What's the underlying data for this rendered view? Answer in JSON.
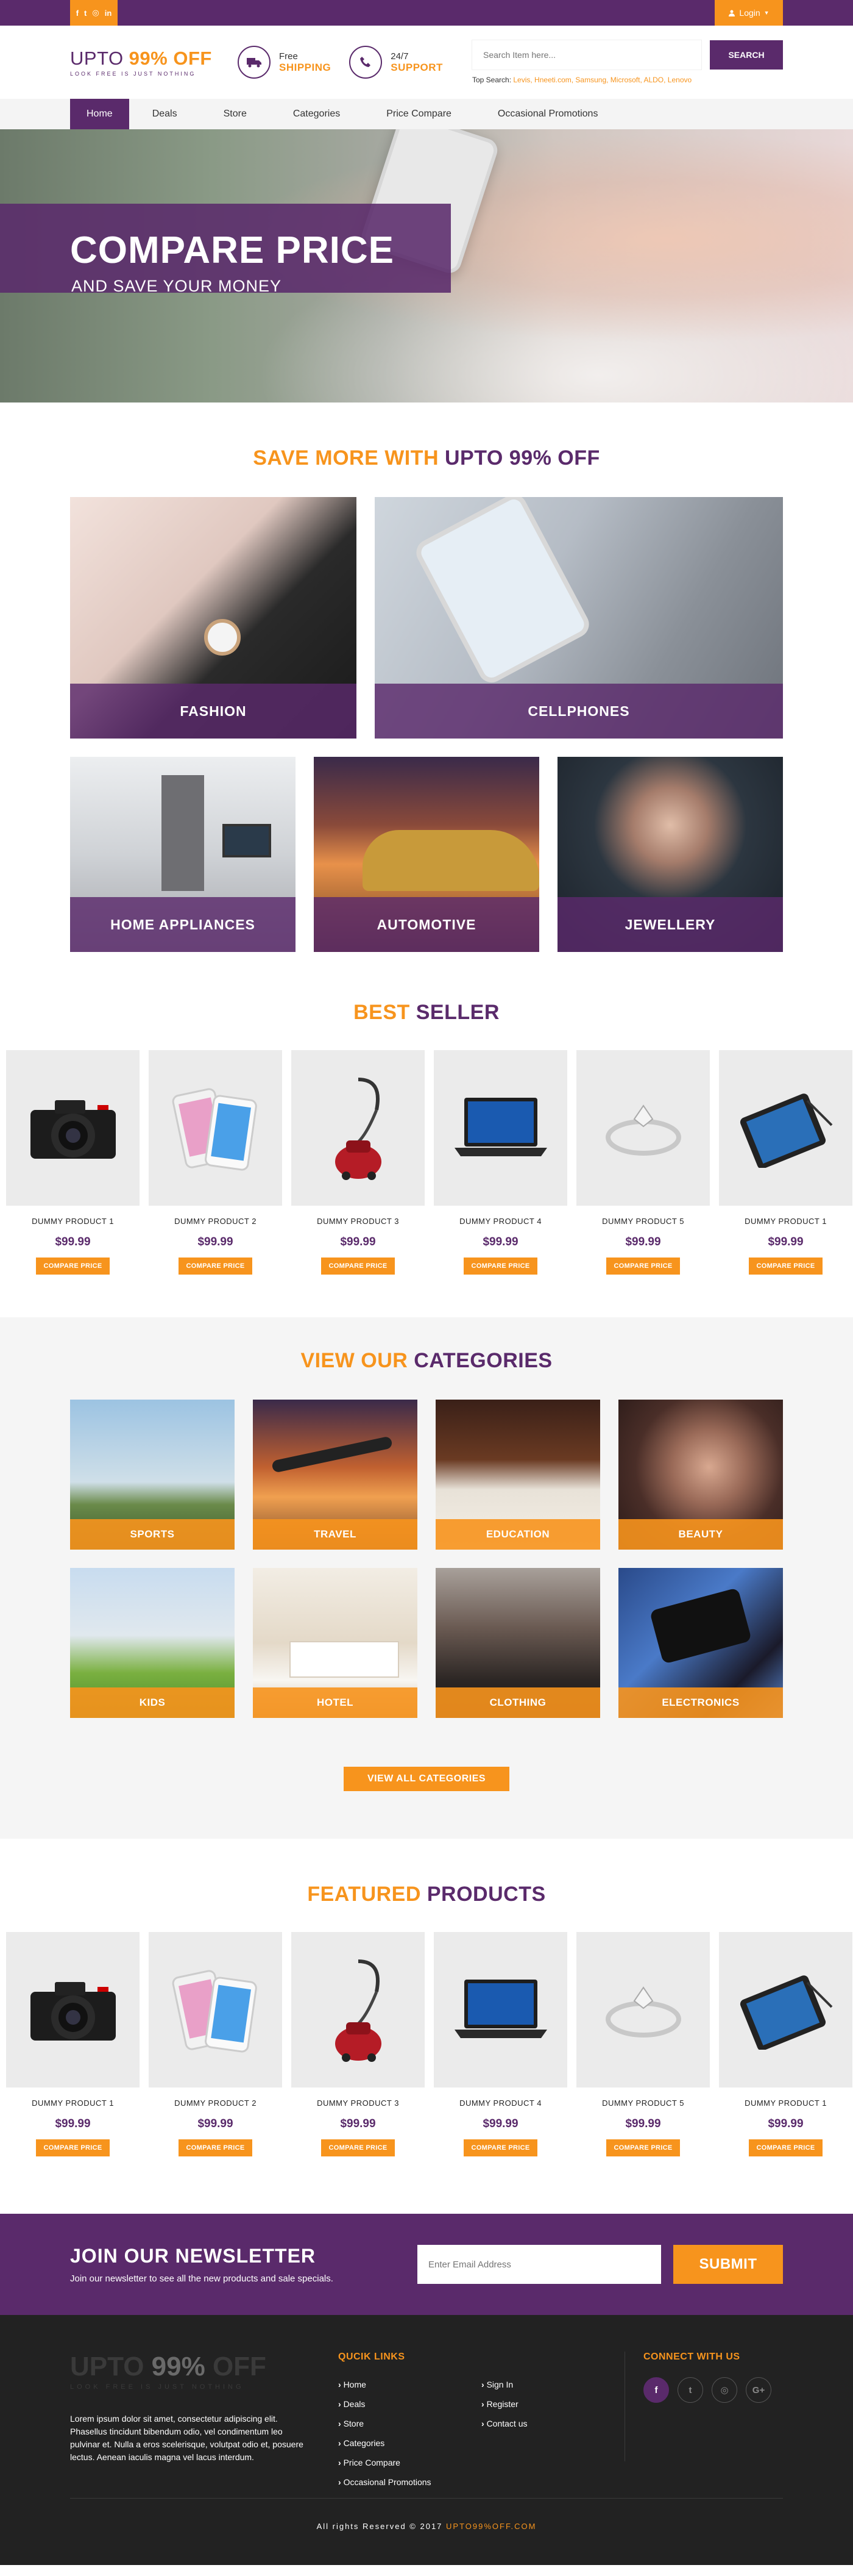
{
  "topbar": {
    "social": [
      "f",
      "t",
      "◎",
      "in"
    ],
    "login_label": "Login"
  },
  "header": {
    "logo_main_a": "UPTO ",
    "logo_main_b": "99% OFF",
    "logo_tagline": "LOOK FREE IS JUST NOTHING",
    "shipping_t1": "Free",
    "shipping_t2": "SHIPPING",
    "support_t1": "24/7",
    "support_t2": "SUPPORT",
    "search_placeholder": "Search Item here...",
    "search_button": "SEARCH",
    "top_search_label": "Top Search: ",
    "top_search_terms": "Levis, Hneeti.com, Samsung, Microsoft, ALDO, Lenovo"
  },
  "nav": [
    "Home",
    "Deals",
    "Store",
    "Categories",
    "Price Compare",
    "Occasional Promotions"
  ],
  "hero": {
    "title": "COMPARE PRICE",
    "subtitle": "AND SAVE YOUR MONEY"
  },
  "save_more": {
    "title_a": "SAVE MORE WITH ",
    "title_b": "UPTO 99% OFF",
    "tiles": [
      "FASHION",
      "CELLPHONES",
      "HOME APPLIANCES",
      "AUTOMOTIVE",
      "JEWELLERY"
    ]
  },
  "best_seller": {
    "title_a": "BEST ",
    "title_b": "SELLER"
  },
  "products": [
    {
      "name": "DUMMY PRODUCT 1",
      "price": "$99.99",
      "button": "COMPARE PRICE",
      "icon": "camera-icon"
    },
    {
      "name": "DUMMY PRODUCT 2",
      "price": "$99.99",
      "button": "COMPARE PRICE",
      "icon": "smartphones-icon"
    },
    {
      "name": "DUMMY PRODUCT 3",
      "price": "$99.99",
      "button": "COMPARE PRICE",
      "icon": "vacuum-icon"
    },
    {
      "name": "DUMMY PRODUCT 4",
      "price": "$99.99",
      "button": "COMPARE PRICE",
      "icon": "laptop-icon"
    },
    {
      "name": "DUMMY PRODUCT 5",
      "price": "$99.99",
      "button": "COMPARE PRICE",
      "icon": "ring-icon"
    },
    {
      "name": "DUMMY PRODUCT 1",
      "price": "$99.99",
      "button": "COMPARE PRICE",
      "icon": "tablet-icon"
    }
  ],
  "categories": {
    "title_a": "VIEW OUR ",
    "title_b": "CATEGORIES",
    "items": [
      "SPORTS",
      "TRAVEL",
      "EDUCATION",
      "BEAUTY",
      "KIDS",
      "HOTEL",
      "CLOTHING",
      "ELECTRONICS"
    ],
    "view_all": "VIEW ALL CATEGORIES"
  },
  "featured": {
    "title_a": "FEATURED ",
    "title_b": "PRODUCTS"
  },
  "newsletter": {
    "title": "JOIN OUR NEWSLETTER",
    "text": "Join our newsletter to see all the new products and sale specials.",
    "placeholder": "Enter Email Address",
    "button": "SUBMIT"
  },
  "footer": {
    "logo_a": "UPTO ",
    "logo_b": "99%",
    "logo_c": " OFF",
    "logo_tagline": "LOOK FREE IS JUST NOTHING",
    "description": "Lorem ipsum dolor sit amet, consectetur adipiscing elit. Phasellus tincidunt bibendum odio, vel condimentum leo pulvinar et. Nulla a eros scelerisque, volutpat odio et, posuere lectus. Aenean iaculis magna vel lacus interdum.",
    "quick_links_title": "QUCIK LINKS",
    "links_col1": [
      "Home",
      "Deals",
      "Store",
      "Categories",
      "Price Compare",
      "Occasional Promotions"
    ],
    "links_col2": [
      "Sign In",
      "Register",
      "Contact us"
    ],
    "connect_title": "CONNECT WITH US",
    "social": [
      "f",
      "t",
      "◎",
      "G+"
    ],
    "copyright": "All rights Reserved © 2017 ",
    "copyright_brand": "UPTO99%OFF.COM"
  },
  "colors": {
    "purple": "#5a2a6b",
    "orange": "#f7941d",
    "footer_bg": "#222222"
  }
}
